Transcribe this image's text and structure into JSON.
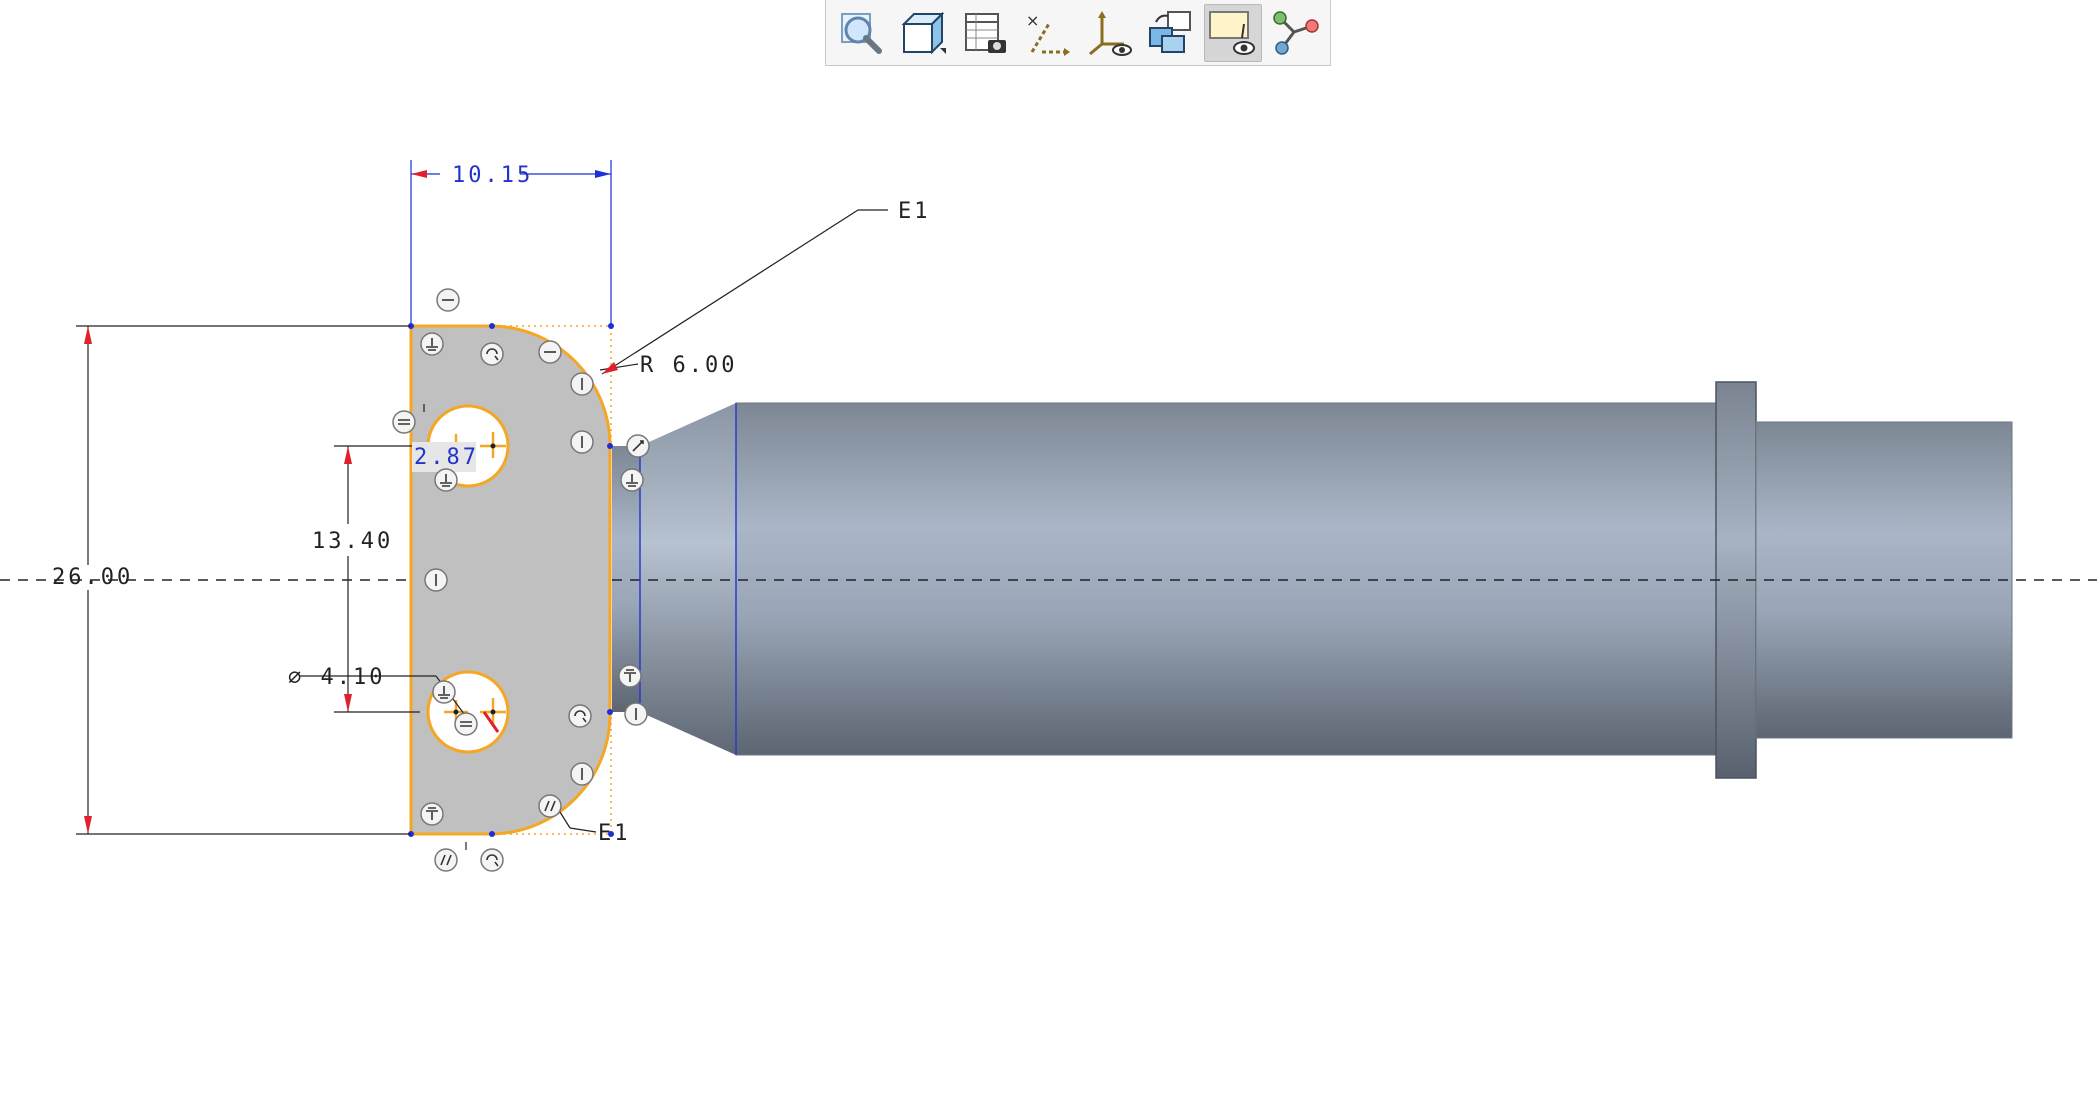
{
  "toolbar": {
    "buttons": [
      {
        "name": "zoom-icon",
        "active": false
      },
      {
        "name": "view-cube-icon",
        "active": false
      },
      {
        "name": "saved-views-icon",
        "active": false
      },
      {
        "name": "datum-display-icon",
        "active": false
      },
      {
        "name": "csys-display-icon",
        "active": false
      },
      {
        "name": "repaint-icon",
        "active": false
      },
      {
        "name": "sketch-view-icon",
        "active": true
      },
      {
        "name": "references-icon",
        "active": false
      }
    ]
  },
  "dimensions": {
    "width_top": "10.15",
    "height": "26.00",
    "spacing": "13.40",
    "hole_diameter": "⌀ 4.10",
    "radius": "R 6.00",
    "small": "2.87",
    "equal_label_top": "E1",
    "equal_label_bottom": "E1"
  },
  "colors": {
    "sketch_orange": "#f5a623",
    "dimension_blue": "#1f2fd6",
    "dimension_red": "#e0202a",
    "part_gray": "#97a3b2"
  }
}
